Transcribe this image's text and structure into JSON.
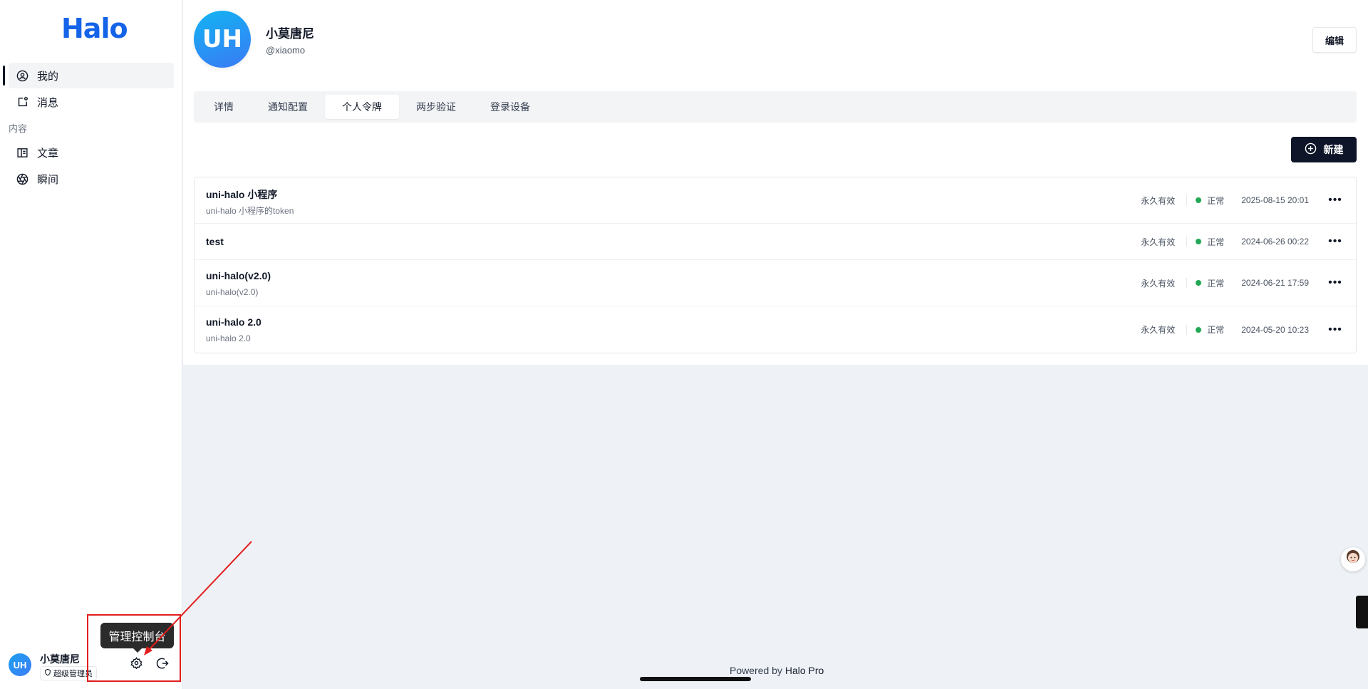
{
  "app": {
    "logo": "Halo"
  },
  "sidebar": {
    "items": [
      {
        "label": "我的",
        "icon": "user-circle-icon",
        "active": true
      },
      {
        "label": "消息",
        "icon": "notification-icon",
        "active": false
      }
    ],
    "group_label": "内容",
    "content_items": [
      {
        "label": "文章",
        "icon": "book-icon"
      },
      {
        "label": "瞬间",
        "icon": "aperture-icon"
      }
    ]
  },
  "user": {
    "avatar_text": "UH",
    "name": "小莫唐尼",
    "role": "超级管理员"
  },
  "tooltip": {
    "text": "管理控制台"
  },
  "profile": {
    "avatar_text": "UH",
    "name": "小莫唐尼",
    "handle": "@xiaomo",
    "edit_label": "编辑"
  },
  "tabs": [
    {
      "label": "详情",
      "active": false
    },
    {
      "label": "通知配置",
      "active": false
    },
    {
      "label": "个人令牌",
      "active": true
    },
    {
      "label": "两步验证",
      "active": false
    },
    {
      "label": "登录设备",
      "active": false
    }
  ],
  "toolbar": {
    "new_label": "新建"
  },
  "tokens": [
    {
      "name": "uni-halo 小程序",
      "description": "uni-halo 小程序的token",
      "validity": "永久有效",
      "status": "正常",
      "date": "2025-08-15 20:01"
    },
    {
      "name": "test",
      "description": "",
      "validity": "永久有效",
      "status": "正常",
      "date": "2024-06-26 00:22"
    },
    {
      "name": "uni-halo(v2.0)",
      "description": "uni-halo(v2.0)",
      "validity": "永久有效",
      "status": "正常",
      "date": "2024-06-21 17:59"
    },
    {
      "name": "uni-halo 2.0",
      "description": "uni-halo 2.0",
      "validity": "永久有效",
      "status": "正常",
      "date": "2024-05-20 10:23"
    }
  ],
  "footer": {
    "powered_prefix": "Powered by",
    "powered_brand": "Halo Pro"
  },
  "colors": {
    "brand": "#1463e8",
    "primary_button": "#0e1528",
    "status_ok": "#22a855",
    "highlight": "#e11d1d"
  }
}
